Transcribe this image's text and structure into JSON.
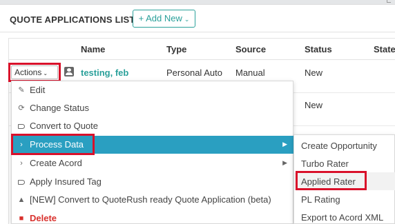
{
  "panel": {
    "title": "QUOTE APPLICATIONS LIST",
    "add_new_label": "+ Add New"
  },
  "table": {
    "columns": [
      "Name",
      "Type",
      "Source",
      "Status",
      "State"
    ],
    "rows": [
      {
        "name": "testing, feb",
        "type": "Personal Auto",
        "source": "Manual",
        "status": "New"
      },
      {
        "name": "",
        "type": "",
        "source": "",
        "status": "New"
      }
    ]
  },
  "actions": {
    "label": "Actions"
  },
  "menu": {
    "items": [
      {
        "label": "Edit",
        "icon": "edit-icon"
      },
      {
        "label": "Change Status",
        "icon": "refresh-icon"
      },
      {
        "label": "Convert to Quote",
        "icon": "tag-icon"
      },
      {
        "label": "Process Data",
        "icon": "chevron-right-icon",
        "has_submenu": true,
        "active": true
      },
      {
        "label": "Create Acord",
        "icon": "chevron-right-icon",
        "has_submenu": true
      },
      {
        "label": "Apply Insured Tag",
        "icon": "tag-icon"
      },
      {
        "label": "[NEW] Convert to QuoteRush ready Quote Application (beta)",
        "icon": "shapes-icon"
      },
      {
        "label": "Delete",
        "icon": "trash-icon",
        "danger": true
      }
    ]
  },
  "submenu": {
    "items": [
      {
        "label": "Create Opportunity"
      },
      {
        "label": "Turbo Rater"
      },
      {
        "label": "Applied Rater",
        "hover": true
      },
      {
        "label": "PL Rating"
      },
      {
        "label": "Export to Acord XML"
      }
    ]
  },
  "colors": {
    "accent": "#2aa09a",
    "menu_active": "#2a9fc1",
    "highlight_box": "#d9102a",
    "danger": "#d9312d"
  }
}
